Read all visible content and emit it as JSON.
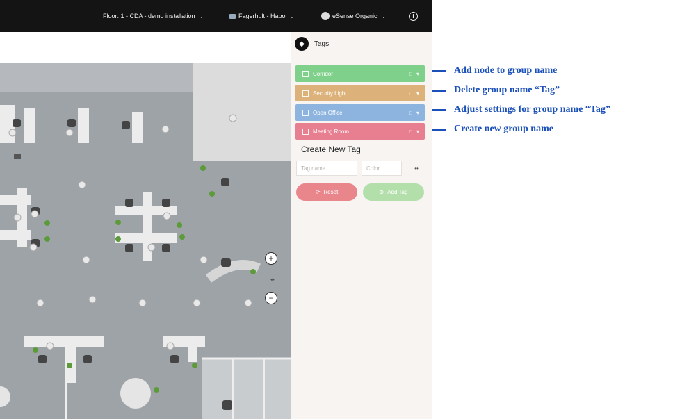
{
  "topbar": {
    "floor_label": "Floor: 1 - CDA - demo installation",
    "building_label": "Fagerhult - Habo",
    "org_label": "eSense Organic"
  },
  "panel": {
    "title": "Tags",
    "tags": [
      {
        "label": "Corridor",
        "color": "#7fd08a"
      },
      {
        "label": "Security Light",
        "color": "#dcb27a"
      },
      {
        "label": "Open Office",
        "color": "#8db4df"
      },
      {
        "label": "Meeting Room",
        "color": "#e77f90"
      }
    ],
    "create_title": "Create New Tag",
    "name_placeholder": "Tag name",
    "color_placeholder": "Color",
    "more_label": "••",
    "reset_label": "Reset",
    "add_label": "Add Tag"
  },
  "annotations": [
    "Add node to group name",
    "Delete group name “Tag”",
    "Adjust settings for group name “Tag”",
    "Create new group name"
  ],
  "colors": {
    "accent": "#1b50b8",
    "floor": "#9ea3a8",
    "topbar": "#141414"
  }
}
